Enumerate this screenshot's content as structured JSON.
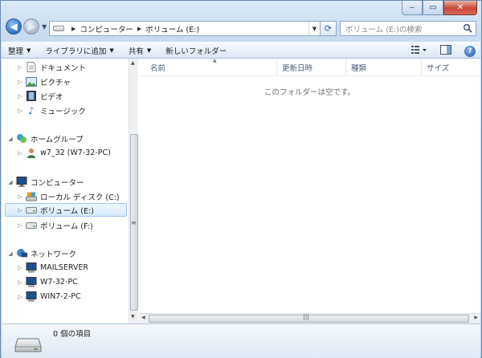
{
  "address": {
    "crumbs": [
      "コンピューター",
      "ボリューム (E:)"
    ]
  },
  "search": {
    "placeholder": "ボリューム (E:)の検索"
  },
  "toolbar": {
    "organize": "整理",
    "add_to_library": "ライブラリに追加",
    "share": "共有",
    "new_folder": "新しいフォルダー"
  },
  "tree": {
    "documents": "ドキュメント",
    "pictures": "ピクチャ",
    "videos": "ビデオ",
    "music": "ミュージック",
    "homegroup": "ホームグループ",
    "homegroup_user": "w7_32 (W7-32-PC)",
    "computer": "コンピューター",
    "local_disk": "ローカル ディスク (C:)",
    "volume_e": "ボリューム (E:)",
    "volume_f": "ボリューム (F:)",
    "network": "ネットワーク",
    "mailserver": "MAILSERVER",
    "w7_32_pc": "W7-32-PC",
    "win7_2_pc": "WIN7-2-PC"
  },
  "columns": {
    "name": "名前",
    "modified": "更新日時",
    "type": "種類",
    "size": "サイズ"
  },
  "list": {
    "empty_message": "このフォルダーは空です。"
  },
  "details": {
    "item_count": "0 個の項目"
  },
  "colors": {
    "selection_border": "#9fc6ef",
    "selection_fill": "#d5e9fc",
    "chrome": "#c9dcef"
  }
}
